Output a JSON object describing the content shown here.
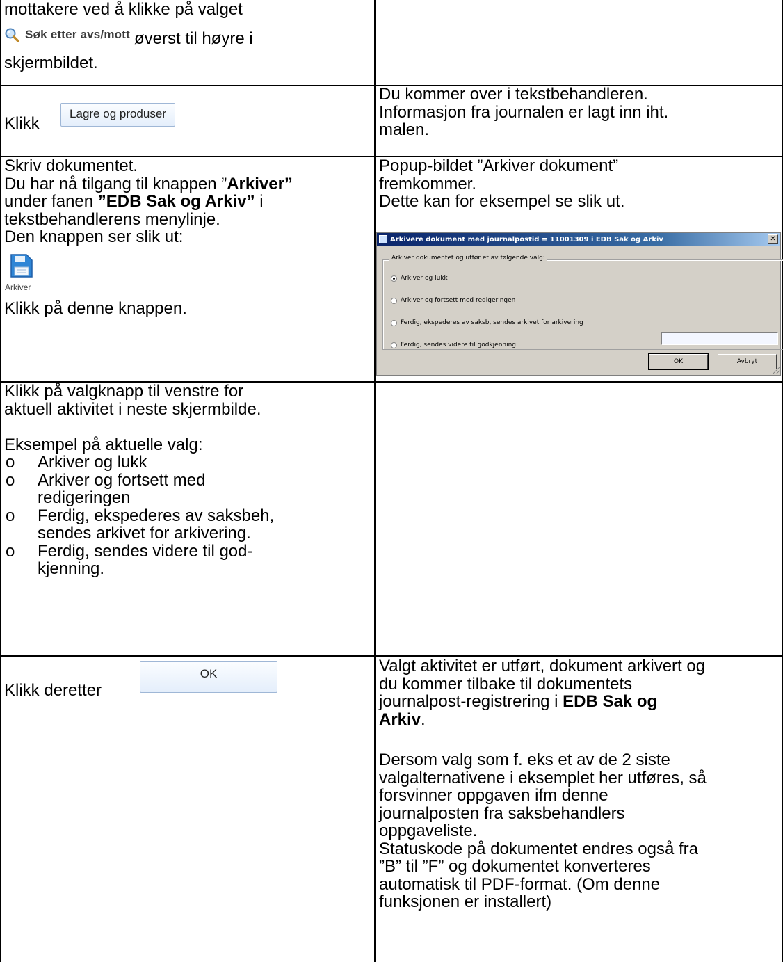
{
  "row1": {
    "line1": "mottakere ved å klikke på valget",
    "search_link_label": "Søk etter avs/mott",
    "line2_tail": "øverst til høyre i",
    "line3": "skjermbildet."
  },
  "row2": {
    "click_label": "Klikk",
    "button_label": "Lagre og produser",
    "result_lines": [
      "Du kommer over i tekstbehandleren.",
      "Informasjon fra journalen er lagt inn iht.",
      "malen."
    ]
  },
  "row3": {
    "l1": "Skriv dokumentet.",
    "l2_pre": "Du har nå tilgang til knappen ”",
    "l2_bold": "Arkiver”",
    "l3_pre": "under fanen ",
    "l3_bold": "”EDB Sak og Arkiv”",
    "l3_post": " i",
    "l4": "tekstbehandlerens menylinje.",
    "l5": "Den knappen ser slik ut:",
    "icon_caption": "Arkiver",
    "l6": "Klikk på denne knappen.",
    "result_lines": [
      "Popup-bildet ”Arkiver dokument”",
      "fremkommer.",
      "Dette kan for eksempel se slik ut."
    ],
    "dialog": {
      "title": "Arkivere dokument med journalpostid = 11001309 i EDB Sak og Arkiv",
      "close_glyph": "✕",
      "group_label": "Arkiver dokumentet og utfør et av følgende valg:",
      "options": [
        "Arkiver og lukk",
        "Arkiver og fortsett med redigeringen",
        "Ferdig, ekspederes av saksb, sendes arkivet for arkivering",
        "Ferdig, sendes videre til godkjenning"
      ],
      "selected_option": "Arkiver og lukk",
      "ok_label": "OK",
      "cancel_label": "Avbryt"
    }
  },
  "row4": {
    "lines": [
      "Klikk på valgknapp til venstre for",
      "aktuell aktivitet i neste skjermbilde."
    ],
    "example_heading": "Eksempel på aktuelle valg:",
    "bullet_mark": "o",
    "bullets": [
      [
        "Arkiver og lukk"
      ],
      [
        "Arkiver og fortsett med",
        "redigeringen"
      ],
      [
        "Ferdig, ekspederes av saksbeh,",
        "sendes arkivet for arkivering."
      ],
      [
        "Ferdig, sendes videre til god-",
        "kjenning."
      ]
    ]
  },
  "row5": {
    "click_label": "Klikk deretter",
    "button_label": "OK",
    "result_l1": "Valgt aktivitet er utført, dokument arkivert og",
    "result_l2": "du kommer tilbake til dokumentets",
    "result_l3_pre": "journalpost-registrering i ",
    "result_l3_bold": "EDB Sak og",
    "result_l4_bold": "Arkiv",
    "result_l4_post": ".",
    "result_more": [
      "Dersom valg som f. eks et av de 2 siste",
      "valgalternativene i eksemplet her utføres, så",
      "forsvinner oppgaven ifm denne",
      "journalposten fra saksbehandlers",
      "oppgaveliste.",
      "Statuskode på dokumentet endres også fra",
      "”B” til ”F” og dokumentet konverteres",
      "automatisk til PDF-format. (Om denne",
      "funksjonen er installert)"
    ]
  }
}
